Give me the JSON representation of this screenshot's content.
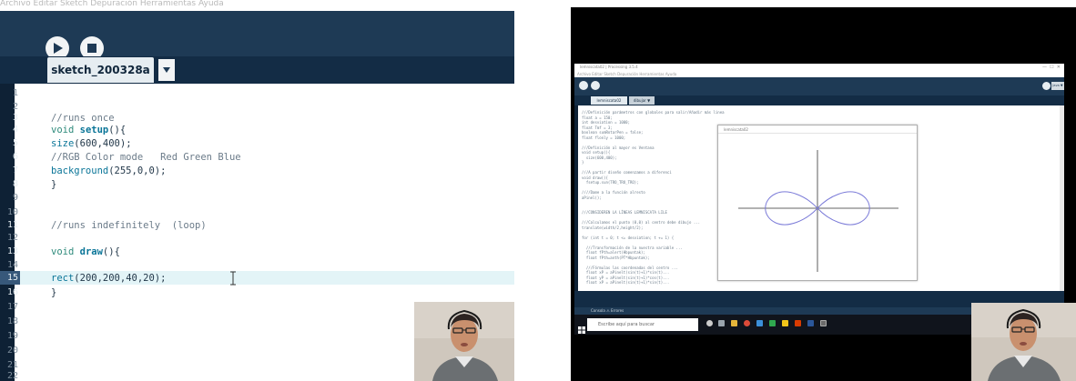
{
  "left_ide": {
    "menu_strip": "Archivo  Editar  Sketch  Depuración  Herramientas  Ayuda",
    "tab_label": "sketch_200328a",
    "line_numbers": [
      "1",
      "2",
      "3",
      "4",
      "5",
      "6",
      "7",
      "8",
      "9",
      "10",
      "11",
      "12",
      "13",
      "14",
      "15",
      "16",
      "17",
      "18",
      "19",
      "20",
      "21",
      "22"
    ],
    "code": {
      "l3": "//runs once",
      "l4_kw": "void",
      "l4_fn": "setup",
      "l4_rest": "(){",
      "l5_fn": "size",
      "l5_rest": "(600,400);",
      "l6": "//RGB Color mode   Red Green Blue",
      "l7_fn": "background",
      "l7_rest": "(255,0,0);",
      "l8": "}",
      "l11": "//runs indefinitely  (loop)",
      "l13_kw": "void",
      "l13_fn": "draw",
      "l13_rest": "(){",
      "l15_fn": "rect",
      "l15_rest": "(200,200,40,20);",
      "l16": "}"
    }
  },
  "right_screen": {
    "title": "lemniscata02 | Processing 3.5.4",
    "menu": "Archivo  Editar  Sketch  Depuración  Herramientas  Ayuda",
    "mode_label": "Java ▼",
    "tabs": [
      "lemniscata02",
      "dibujar ▼"
    ],
    "sketch_window_title": "lemniscata02",
    "console_tabs": "Consola     ⚠ Errores",
    "search_placeholder": "Escribe aquí para buscar",
    "code_lines": [
      "///Definición parámetros con globales para salir/Añadir más linea",
      "float a = 150;",
      "int desviation = 1000;",
      "float Tmf = 3;",
      "boolean sumRotarPen = false;",
      "float flonly = 1000;",
      "",
      "///Definición al mayor es Ventana",
      "void setup(){",
      "  size(600,400);",
      "}",
      "",
      "///A partir diseño comenzamos a diferenci",
      "void draw(){",
      "  fsetup.sun(TRO_TRO_TRO);",
      "",
      "////Dame a la función alresto",
      "aPinel();",
      "",
      "",
      "///CONSIDEREN LA LÍNEAS LEMNISCATA LILE",
      "",
      "///Calculamos el punto (0,0) al centro debe dibujo ...",
      "translate(width/2,height/2);",
      "",
      "for (int t = 0; t <= desviation; t += 1) {",
      "",
      "  ///Transformación de la nuestra variable ...",
      "  float fPth=alert(Hbpuntak);",
      "  float fPth=anth(PT*Hbpuntak);",
      "",
      "  ///Fórmulas las coordenadas del centro ...",
      "  float xP = aPinelt(sin(t)+1)*sin(t)...",
      "  float yP = aPinelt(sin(t)+1)*cos(t)...",
      "  float xP = aPinelt(sin(t)+1)*sin(t)..."
    ]
  },
  "colors": {
    "ide_toolbar": "#1e3a55",
    "ide_tabbar": "#132c45",
    "ide_gutter": "#0e2135",
    "highlight_line": "#e3f4f7",
    "lemniscate": "#7b7bd8"
  }
}
